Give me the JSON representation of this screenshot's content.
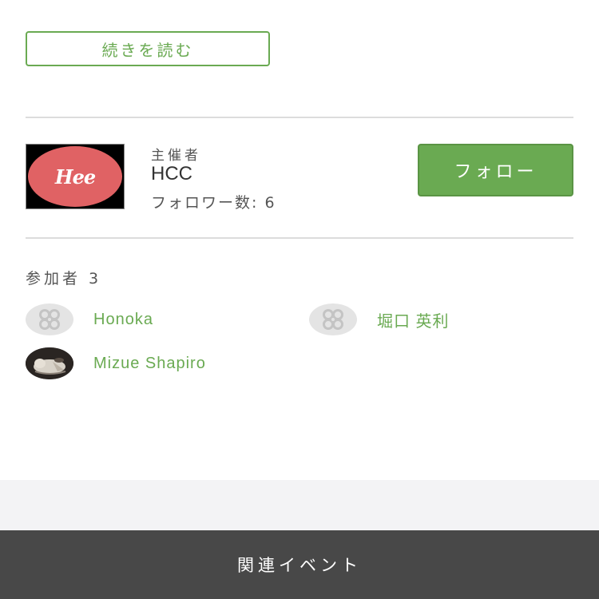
{
  "read_more": {
    "label": "続きを読む"
  },
  "organizer": {
    "role_label": "主催者",
    "name": "HCC",
    "logo_text": "Hee",
    "followers": "フォロワー数: 6",
    "follow_label": "フォロー"
  },
  "participants": {
    "header": "参加者 3",
    "items": [
      {
        "name": "Honoka",
        "avatar": "default-avatar-icon"
      },
      {
        "name": "堀口 英利",
        "avatar": "default-avatar-icon"
      },
      {
        "name": "Mizue Shapiro",
        "avatar": "cat-photo"
      }
    ]
  },
  "footer": {
    "label": "関連イベント"
  },
  "colors": {
    "accent_green": "#6aaa52",
    "logo_red": "#e06264",
    "footer_bg": "#484848",
    "band_bg": "#f3f3f5"
  }
}
